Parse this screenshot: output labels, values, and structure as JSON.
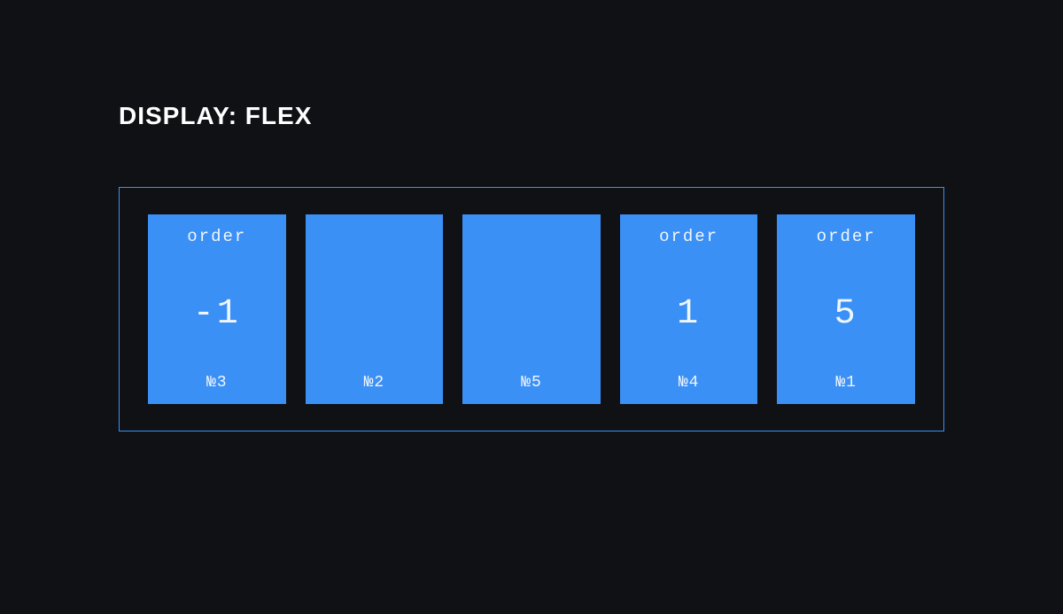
{
  "title": "DISPLAY: FLEX",
  "order_property_label": "order",
  "items": [
    {
      "show_order": true,
      "order_value": "-1",
      "num_label": "№3"
    },
    {
      "show_order": false,
      "order_value": "",
      "num_label": "№2"
    },
    {
      "show_order": false,
      "order_value": "",
      "num_label": "№5"
    },
    {
      "show_order": true,
      "order_value": "1",
      "num_label": "№4"
    },
    {
      "show_order": true,
      "order_value": "5",
      "num_label": "№1"
    }
  ],
  "colors": {
    "background": "#0f1115",
    "accent": "#3b90f5",
    "text": "#ffffff"
  }
}
